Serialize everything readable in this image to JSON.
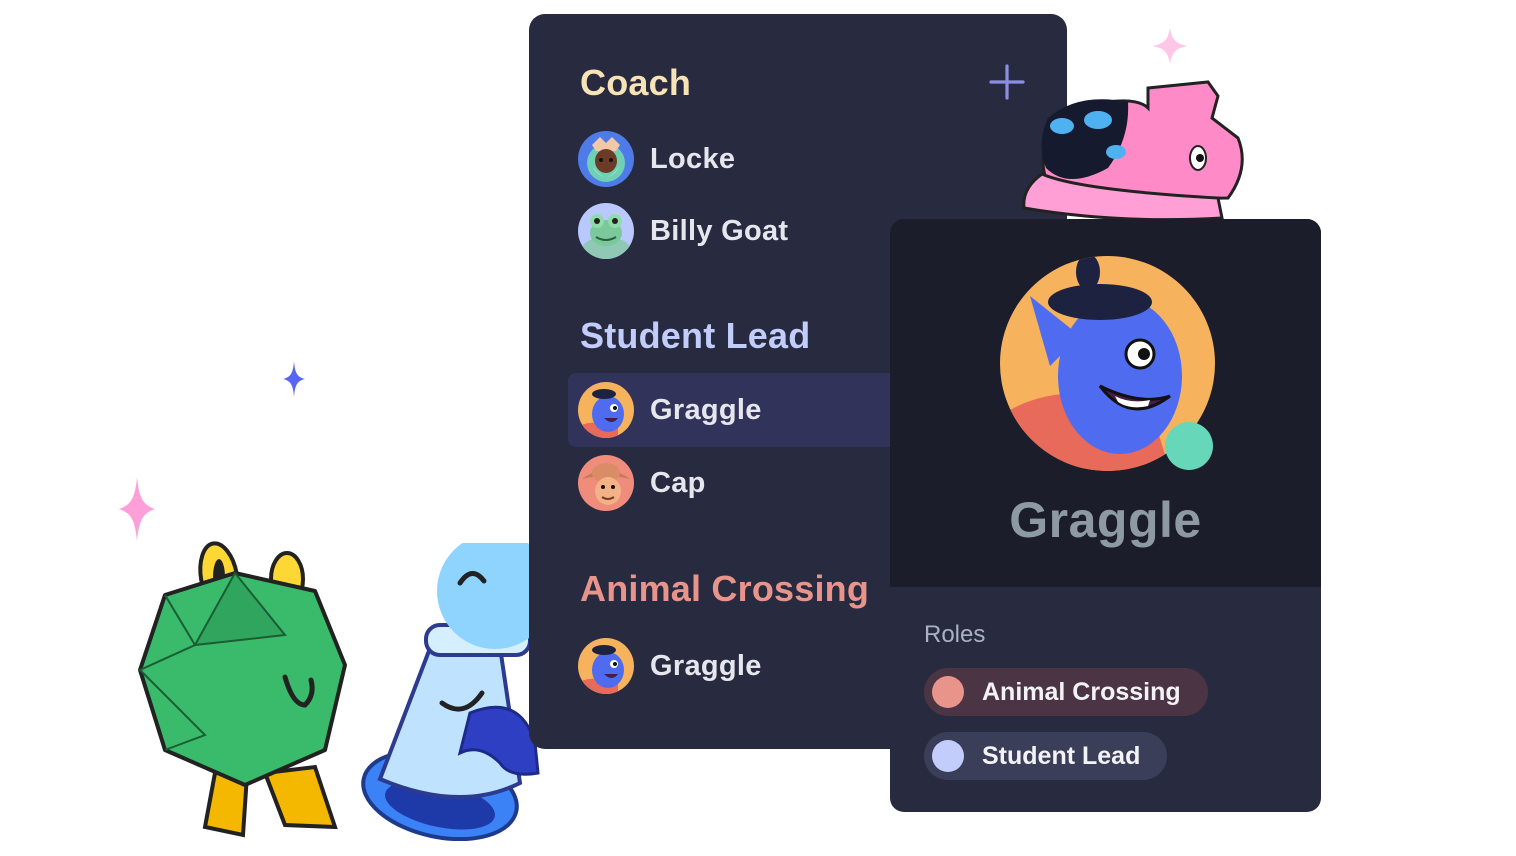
{
  "member_list": {
    "add_icon": "plus-icon",
    "groups": [
      {
        "title": "Coach",
        "color": "#f7e3b5",
        "members": [
          {
            "name": "Locke",
            "avatar": "old-man-avatar"
          },
          {
            "name": "Billy Goat",
            "avatar": "frog-avatar"
          }
        ]
      },
      {
        "title": "Student Lead",
        "color": "#c2cdfc",
        "members": [
          {
            "name": "Graggle",
            "avatar": "genie-avatar",
            "selected": true
          },
          {
            "name": "Cap",
            "avatar": "cowboy-avatar"
          }
        ]
      },
      {
        "title": "Animal Crossing",
        "color": "#e8948b",
        "members": [
          {
            "name": "Graggle",
            "avatar": "genie-avatar"
          }
        ]
      }
    ]
  },
  "profile": {
    "name": "Graggle",
    "status_color": "#66d7b8",
    "roles_heading": "Roles",
    "roles": [
      {
        "name": "Animal Crossing",
        "color": "#e8948b",
        "pill_color": "#4b3443"
      },
      {
        "name": "Student Lead",
        "color": "#c2cdfc",
        "pill_color": "#3b3e59"
      }
    ]
  }
}
